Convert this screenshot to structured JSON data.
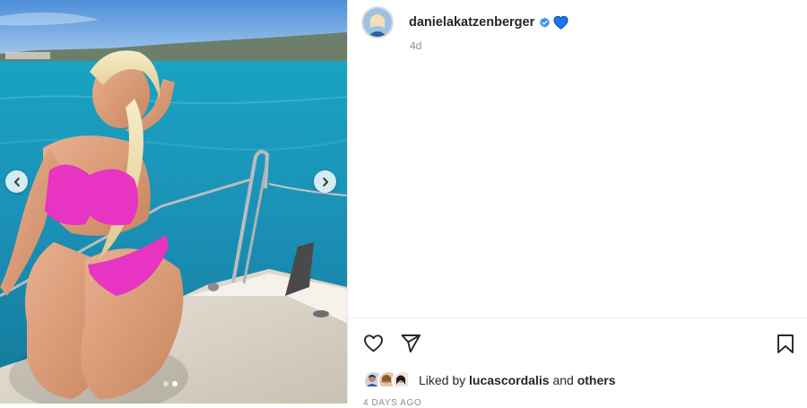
{
  "post": {
    "username": "danielakatzenberger",
    "time_ago": "4d",
    "liked_prefix": "Liked by",
    "liked_user": "lucascordalis",
    "liked_conjunction": "and",
    "liked_others": "others",
    "date_partial": "4 DAYS AGO"
  },
  "carousel": {
    "slides": 2,
    "active_index": 1
  },
  "icons": {
    "verified": "verified-badge-icon",
    "emoji": "blue-heart-icon",
    "like": "heart-outline-icon",
    "share": "paper-plane-icon",
    "save": "bookmark-icon",
    "prev": "chevron-left-icon",
    "next": "chevron-right-icon"
  },
  "colors": {
    "verified": "#3797f0",
    "blue_heart": "#1877f2",
    "text": "#262626",
    "muted": "#8e8e8e"
  }
}
